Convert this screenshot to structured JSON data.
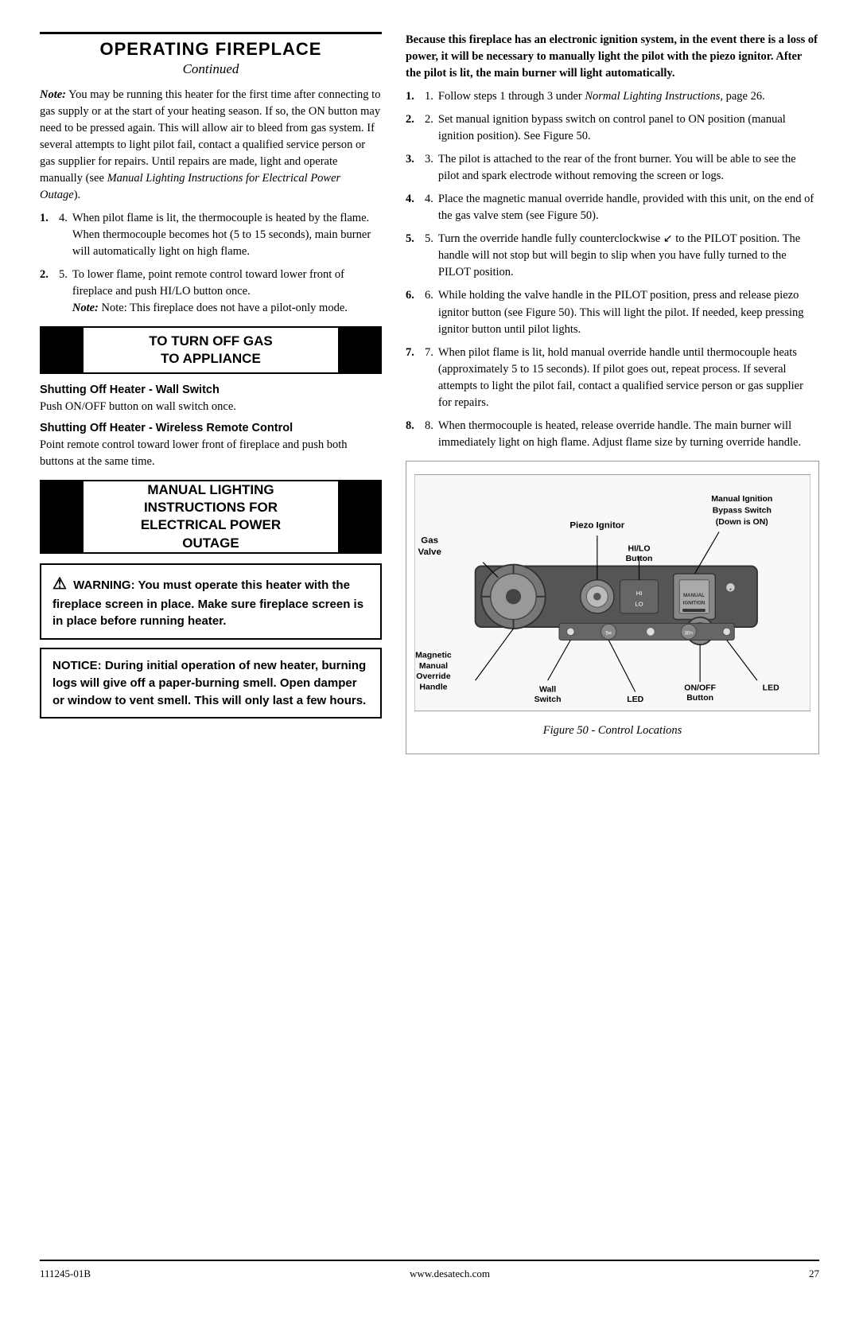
{
  "header": {
    "title": "OPERATING FIREPLACE",
    "subtitle": "Continued"
  },
  "left_col": {
    "note_paragraph": "Note: You may be running this heater for the first time after connecting to gas supply or at the start of your heating season. If so, the ON button may need to be pressed again. This will allow air to bleed from gas system. If several attempts to light pilot fail, contact a qualified service person or gas supplier for repairs. Until repairs are made, light and operate manually (see Manual Lighting Instructions for Electrical Power Outage).",
    "item4": "When pilot flame is lit, the thermocouple is heated by the flame. When thermocouple becomes hot (5 to 15 seconds), main burner will automatically light on high flame.",
    "item5_start": "To lower flame, point remote control toward lower front of fireplace and push HI/LO button once.",
    "item5_note": "Note: This fireplace does not have a pilot-only mode.",
    "banner_turn_off_line1": "TO TURN OFF GAS",
    "banner_turn_off_line2": "TO APPLIANCE",
    "shut_off_head1": "Shutting Off Heater - Wall Switch",
    "shut_off_body1": "Push ON/OFF button on wall switch once.",
    "shut_off_head2": "Shutting Off Heater - Wireless Remote Control",
    "shut_off_body2": "Point remote control toward lower front of fireplace and push both buttons at the same time.",
    "manual_lighting_line1": "MANUAL LIGHTING",
    "manual_lighting_line2": "INSTRUCTIONS FOR",
    "manual_lighting_line3": "ELECTRICAL POWER",
    "manual_lighting_line4": "OUTAGE",
    "warning_text": "WARNING: You must operate this heater with the fireplace screen in place. Make sure fireplace screen is in place before running heater.",
    "notice_text": "NOTICE: During initial operation of new heater, burning logs will give off a paper-burning smell. Open damper or window to vent smell. This will only last a few hours."
  },
  "right_col": {
    "intro": "Because this fireplace has an electronic ignition system, in the event there is a loss of power, it will be necessary to manually light the pilot with the piezo ignitor. After the pilot is lit, the main burner will light automatically.",
    "items": [
      {
        "num": 1,
        "text": "Follow steps 1 through 3 under Normal Lighting Instructions, page 26.",
        "italic_parts": [
          "Normal Lighting Instructions,"
        ]
      },
      {
        "num": 2,
        "text": "Set manual ignition bypass switch on control panel to ON position (manual ignition position). See Figure 50."
      },
      {
        "num": 3,
        "text": "The pilot is attached to the rear of the front burner. You will be able to see the pilot and spark electrode without removing the screen or logs."
      },
      {
        "num": 4,
        "text": "Place the magnetic manual override handle, provided with this unit, on the end of the gas valve stem (see Figure 50)."
      },
      {
        "num": 5,
        "text": "Turn the override handle fully counterclockwise [arrow] to the PILOT position. The handle will not stop but will begin to slip when you have fully turned to the PILOT position."
      },
      {
        "num": 6,
        "text": "While holding the valve handle in the PILOT position, press and release piezo ignitor button (see Figure 50). This will light the pilot. If needed, keep pressing ignitor button until pilot lights."
      },
      {
        "num": 7,
        "text": "When pilot flame is lit, hold manual override handle until thermocouple heats (approximately 5 to 15 seconds). If pilot goes out, repeat process. If several attempts to light the pilot fail, contact a qualified service person or gas supplier for repairs."
      },
      {
        "num": 8,
        "text": "When thermocouple is heated, release override handle. The main burner will immediately light on high flame. Adjust flame size by turning override handle."
      }
    ],
    "figure": {
      "caption": "Figure 50 - Control Locations",
      "labels": {
        "gas_valve": "Gas\nValve",
        "piezo_ignitor": "Piezo Ignitor",
        "manual_ignition": "Manual Ignition\nBypass Switch\n(Down is ON)",
        "hi_lo_button": "HI/LO\nButton",
        "magnetic": "Magnetic\nManual\nOverride\nHandle",
        "wall_switch": "Wall\nSwitch",
        "led_left": "LED",
        "on_off_button": "ON/OFF\nButton",
        "led_right": "LED"
      }
    }
  },
  "footer": {
    "part_number": "111245-01B",
    "website": "www.desatech.com",
    "page_number": "27"
  }
}
